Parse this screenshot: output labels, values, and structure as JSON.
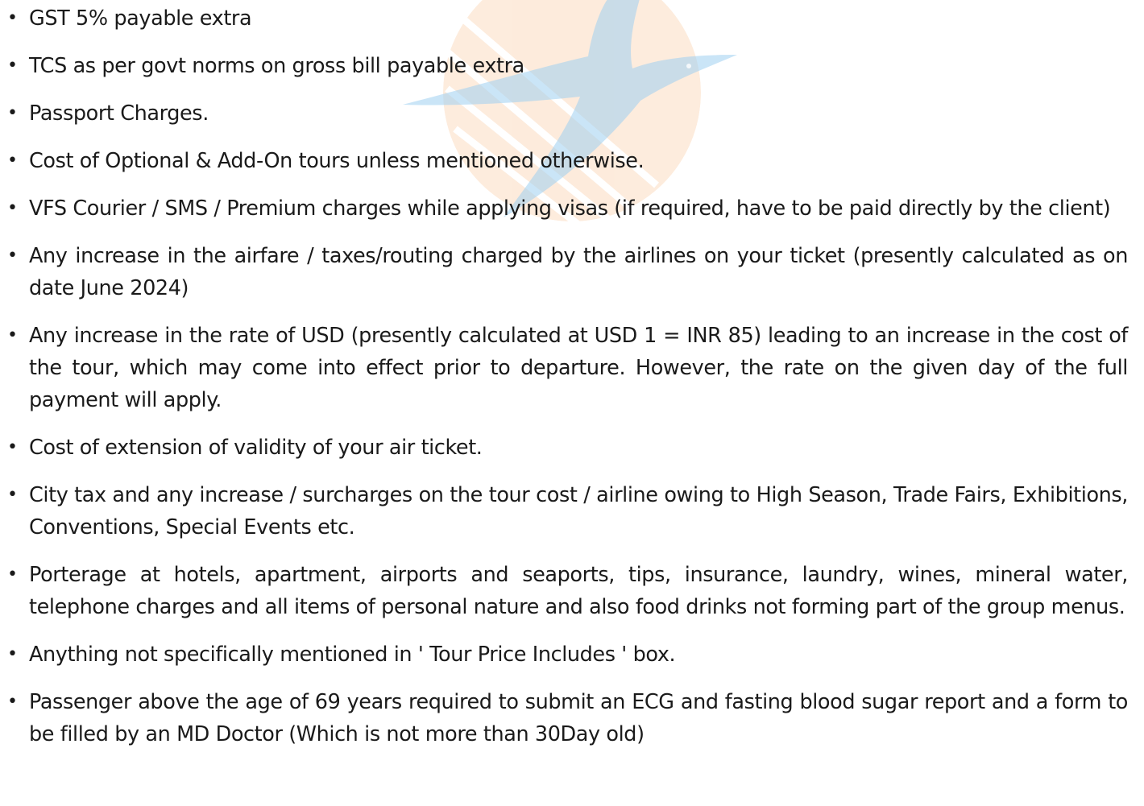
{
  "inclusions_excluded": {
    "items": [
      "GST 5% payable extra",
      "TCS as per govt norms on gross bill payable extra",
      "Passport Charges.",
      "Cost of Optional & Add-On tours unless mentioned otherwise.",
      "VFS Courier / SMS / Premium charges while applying visas (if required, have to be paid directly by the client)",
      "Any increase in the airfare / taxes/routing charged by the airlines on your ticket (presently calculated as on date June 2024)",
      "Any increase in the rate of USD (presently calculated at USD 1 = INR 85) leading to an increase in the cost of the tour, which may come into effect prior to departure. However, the rate on the given day of the full payment will apply.",
      "Cost of extension of validity of your air ticket.",
      "City tax and any increase / surcharges on the tour cost / airline owing to High Season, Trade Fairs, Exhibitions, Conventions, Special Events etc.",
      "Porterage at hotels, apartment, airports and seaports, tips, insurance, laundry, wines, mineral water, telephone charges and all items of personal nature and also food drinks not forming part of the group menus.",
      "Anything not specifically mentioned in ' Tour Price Includes ' box.",
      "Passenger above the age of 69 years required to submit an ECG and fasting blood sugar report and a form to be filled by an MD Doctor (Which is not more than 30Day old)"
    ],
    "bullet_glyph": "•"
  },
  "watermark": {
    "icon": "bird-sun-logo-icon",
    "colors": {
      "sun": "#f7b98a",
      "bird": "#8ec6ea"
    }
  }
}
